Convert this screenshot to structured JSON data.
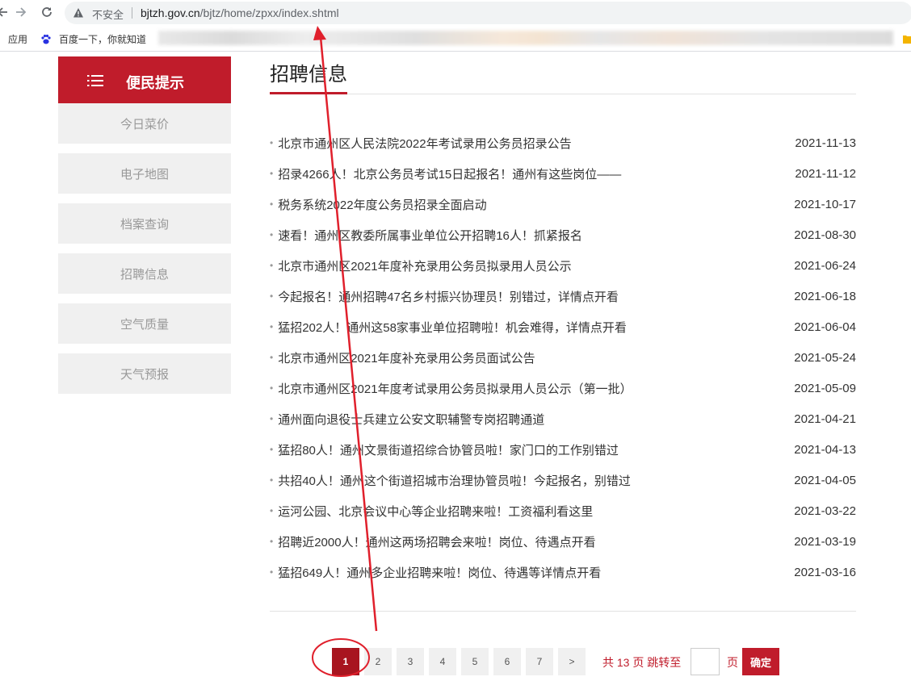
{
  "browser": {
    "security_label": "不安全",
    "url_host": "bjtzh.gov.cn",
    "url_path": "/bjtz/home/zpxx/index.shtml",
    "bookmarks": {
      "apps_label": "应用",
      "baidu_label": "百度一下，你就知道"
    }
  },
  "sidebar": {
    "title": "便民提示",
    "items": [
      {
        "label": "今日菜价"
      },
      {
        "label": "电子地图"
      },
      {
        "label": "档案查询"
      },
      {
        "label": "招聘信息"
      },
      {
        "label": "空气质量"
      },
      {
        "label": "天气预报"
      }
    ]
  },
  "main": {
    "title": "招聘信息",
    "articles": [
      {
        "title": "北京市通州区人民法院2022年考试录用公务员招录公告",
        "date": "2021-11-13"
      },
      {
        "title": "招录4266人！北京公务员考试15日起报名！通州有这些岗位——",
        "date": "2021-11-12"
      },
      {
        "title": "税务系统2022年度公务员招录全面启动",
        "date": "2021-10-17"
      },
      {
        "title": "速看！通州区教委所属事业单位公开招聘16人！抓紧报名",
        "date": "2021-08-30"
      },
      {
        "title": "北京市通州区2021年度补充录用公务员拟录用人员公示",
        "date": "2021-06-24"
      },
      {
        "title": "今起报名！通州招聘47名乡村振兴协理员！别错过，详情点开看",
        "date": "2021-06-18"
      },
      {
        "title": "猛招202人！通州这58家事业单位招聘啦！机会难得，详情点开看",
        "date": "2021-06-04"
      },
      {
        "title": "北京市通州区2021年度补充录用公务员面试公告",
        "date": "2021-05-24"
      },
      {
        "title": "北京市通州区2021年度考试录用公务员拟录用人员公示（第一批）",
        "date": "2021-05-09"
      },
      {
        "title": "通州面向退役士兵建立公安文职辅警专岗招聘通道",
        "date": "2021-04-21"
      },
      {
        "title": "猛招80人！通州文景街道招综合协管员啦！家门口的工作别错过",
        "date": "2021-04-13"
      },
      {
        "title": "共招40人！通州这个街道招城市治理协管员啦！今起报名，别错过",
        "date": "2021-04-05"
      },
      {
        "title": "运河公园、北京会议中心等企业招聘来啦！工资福利看这里",
        "date": "2021-03-22"
      },
      {
        "title": "招聘近2000人！通州这两场招聘会来啦！岗位、待遇点开看",
        "date": "2021-03-19"
      },
      {
        "title": "猛招649人！通州多企业招聘来啦！岗位、待遇等详情点开看",
        "date": "2021-03-16"
      }
    ]
  },
  "pagination": {
    "pages": [
      "1",
      "2",
      "3",
      "4",
      "5",
      "6",
      "7"
    ],
    "current": "1",
    "next_label": ">",
    "total_text": "共 13 页 跳转至",
    "page_suffix": "页",
    "jump_value": "",
    "confirm_label": "确定"
  },
  "colors": {
    "accent_red": "#c01c2b",
    "active_page": "#a8151f",
    "annotation_red": "#e0202c"
  }
}
